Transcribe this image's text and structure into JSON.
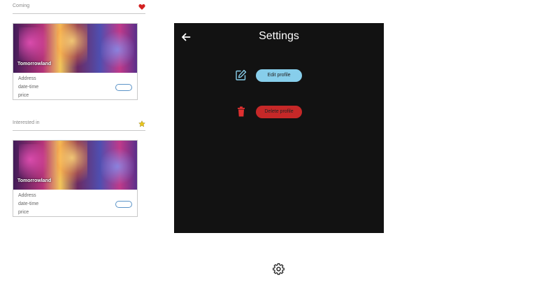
{
  "sections": [
    {
      "label": "Coming",
      "icon": "heart-icon",
      "card": {
        "title": "Tomorrowland",
        "address": "Address",
        "datetime": "date-time",
        "price": "price"
      }
    },
    {
      "label": "Interested in",
      "icon": "star-icon",
      "card": {
        "title": "Tomorrowland",
        "address": "Address",
        "datetime": "date-time",
        "price": "price"
      }
    }
  ],
  "settings": {
    "title": "Settings",
    "edit_label": "Edit profile",
    "delete_label": "Delete profile"
  },
  "colors": {
    "panel_bg": "#121212",
    "edit_accent": "#87ceeb",
    "delete_accent": "#c62828",
    "heart": "#d32020",
    "star": "#e8c51a"
  }
}
